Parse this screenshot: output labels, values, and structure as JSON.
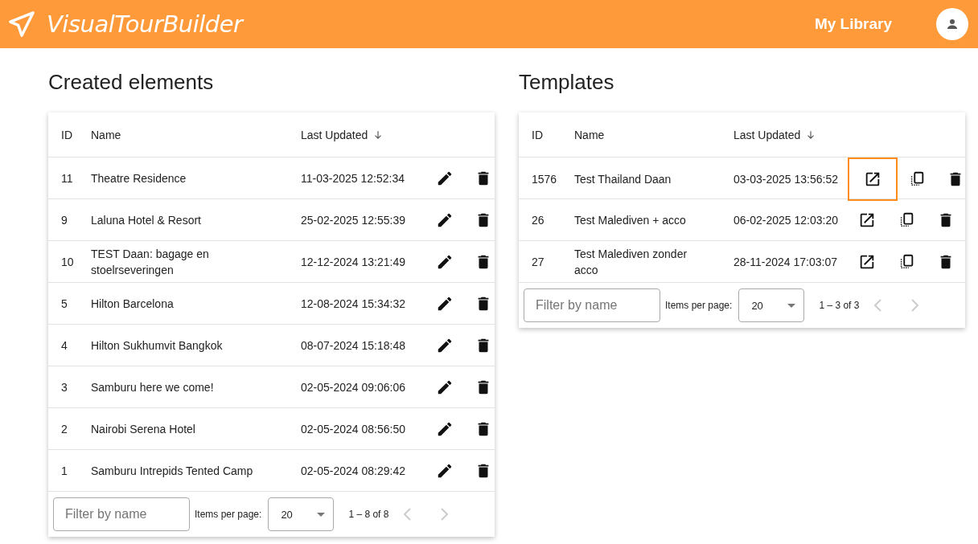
{
  "header": {
    "brand": "VisualTourBuilder",
    "nav_link": "My Library"
  },
  "created": {
    "title": "Created elements",
    "columns": [
      "ID",
      "Name",
      "Last Updated"
    ],
    "rows": [
      {
        "id": "11",
        "name": "Theatre Residence",
        "updated": "11-03-2025 12:52:34"
      },
      {
        "id": "9",
        "name": "Laluna Hotel & Resort",
        "updated": "25-02-2025 12:55:39"
      },
      {
        "id": "10",
        "name": "TEST Daan: bagage en stoelrseveringen",
        "updated": "12-12-2024 13:21:49"
      },
      {
        "id": "5",
        "name": "Hilton Barcelona",
        "updated": "12-08-2024 15:34:32"
      },
      {
        "id": "4",
        "name": "Hilton Sukhumvit Bangkok",
        "updated": "08-07-2024 15:18:48"
      },
      {
        "id": "3",
        "name": "Samburu here we come!",
        "updated": "02-05-2024 09:06:06"
      },
      {
        "id": "2",
        "name": "Nairobi Serena Hotel",
        "updated": "02-05-2024 08:56:50"
      },
      {
        "id": "1",
        "name": "Samburu Intrepids Tented Camp",
        "updated": "02-05-2024 08:29:42"
      }
    ],
    "filter": {
      "placeholder": "Filter by name"
    },
    "items_per_page_label": "Items per page:",
    "items_per_page": "20",
    "range": "1 – 8 of 8"
  },
  "templates": {
    "title": "Templates",
    "columns": [
      "ID",
      "Name",
      "Last Updated"
    ],
    "rows": [
      {
        "id": "1576",
        "name": "Test Thailand Daan",
        "updated": "03-03-2025 13:56:52",
        "highlighted": true
      },
      {
        "id": "26",
        "name": "Test Malediven + acco",
        "updated": "06-02-2025 12:03:20",
        "highlighted": false
      },
      {
        "id": "27",
        "name": "Test Malediven zonder acco",
        "updated": "28-11-2024 17:03:07",
        "highlighted": false
      }
    ],
    "filter": {
      "placeholder": "Filter by name"
    },
    "items_per_page_label": "Items per page:",
    "items_per_page": "20",
    "range": "1 – 3 of 3"
  }
}
